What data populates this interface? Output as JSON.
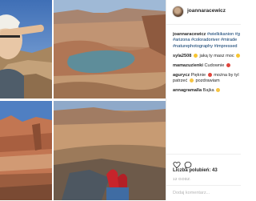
{
  "post": {
    "username": "joannaracewicz",
    "comments": [
      {
        "user": "joannaracewicz",
        "lines": [
          "#wielkikanion #g",
          "#arizona #coloradoriver #mirade",
          "#naturephotography #impressed"
        ]
      },
      {
        "user": "syla2508",
        "text": "jaką ty masz moc"
      },
      {
        "user": "mamazuzienki",
        "text": "Cudownie"
      },
      {
        "user": "agurycz",
        "text": "Pięknie",
        "text2": "można by tyl",
        "line2": "patrzeć",
        "line2b": "pozdrawiam"
      },
      {
        "user": "annagramalla",
        "text": "Bajka"
      }
    ],
    "likes": "Liczba polubień: 43",
    "date": "12 GODZ.",
    "add_comment_placeholder": "Dodaj komentarz..."
  },
  "photos": [
    {
      "id": "photo-selfie"
    },
    {
      "id": "photo-canyon-river"
    },
    {
      "id": "photo-canyon-cliffs"
    },
    {
      "id": "photo-red-shoes"
    }
  ],
  "colors": {
    "sky": "#5a86c4",
    "rock": "#b27a56",
    "river": "#5a8f9e",
    "text": "#262626",
    "muted": "#999999"
  }
}
